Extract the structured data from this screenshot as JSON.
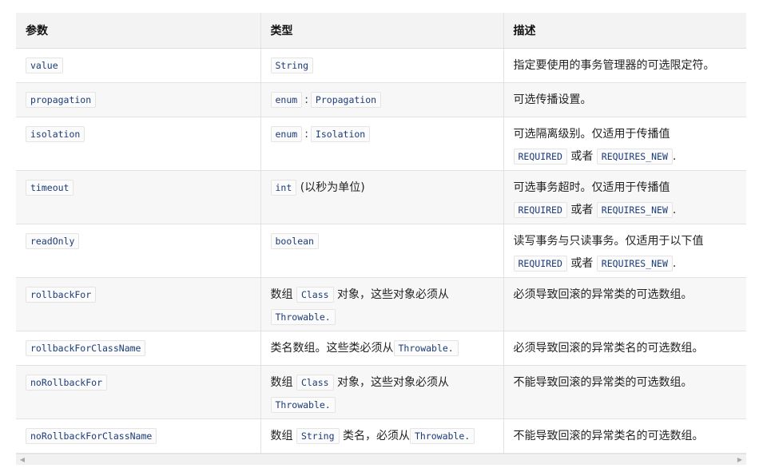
{
  "table": {
    "headers": [
      "参数",
      "类型",
      "描述"
    ],
    "rows": [
      {
        "param": "value",
        "type_code": "String",
        "desc": "指定要使用的事务管理器的可选限定符。"
      },
      {
        "param": "propagation",
        "type_code1": "enum",
        "type_sep": ":",
        "type_code2": "Propagation",
        "desc": "可选传播设置。"
      },
      {
        "param": "isolation",
        "type_code1": "enum",
        "type_sep": ":",
        "type_code2": "Isolation",
        "desc": "可选隔离级别。仅适用于传播值",
        "code_a": "REQUIRED",
        "or_text": "或者",
        "code_b": "REQUIRES_NEW",
        "end": "."
      },
      {
        "param": "timeout",
        "type_code": "int",
        "type_text": "(以秒为单位)",
        "desc": "可选事务超时。仅适用于传播值",
        "code_a": "REQUIRED",
        "or_text": "或者",
        "code_b": "REQUIRES_NEW",
        "end": "."
      },
      {
        "param": "readOnly",
        "type_code": "boolean",
        "desc": "读写事务与只读事务。仅适用于以下值",
        "code_a": "REQUIRED",
        "or_text": "或者",
        "code_b": "REQUIRES_NEW",
        "end": "."
      },
      {
        "param": "rollbackFor",
        "type_pre": "数组",
        "type_code1": "Class",
        "type_mid": "对象，这些对象必须从",
        "type_code2": "Throwable.",
        "desc": "必须导致回滚的异常类的可选数组。"
      },
      {
        "param": "rollbackForClassName",
        "type_pre": "类名数组。这些类必须从",
        "type_code2": "Throwable.",
        "desc": "必须导致回滚的异常类名的可选数组。"
      },
      {
        "param": "noRollbackFor",
        "type_pre": "数组",
        "type_code1": "Class",
        "type_mid": "对象，这些对象必须从",
        "type_code2": "Throwable.",
        "desc": "不能导致回滚的异常类的可选数组。"
      },
      {
        "param": "noRollbackForClassName",
        "type_pre": "数组",
        "type_code1": "String",
        "type_mid": "类名，必须从",
        "type_code2": "Throwable.",
        "desc": "不能导致回滚的异常类名的可选数组。"
      }
    ]
  },
  "scrollbar": {
    "left_icon": "triangle-left-icon",
    "right_icon": "triangle-right-icon"
  }
}
